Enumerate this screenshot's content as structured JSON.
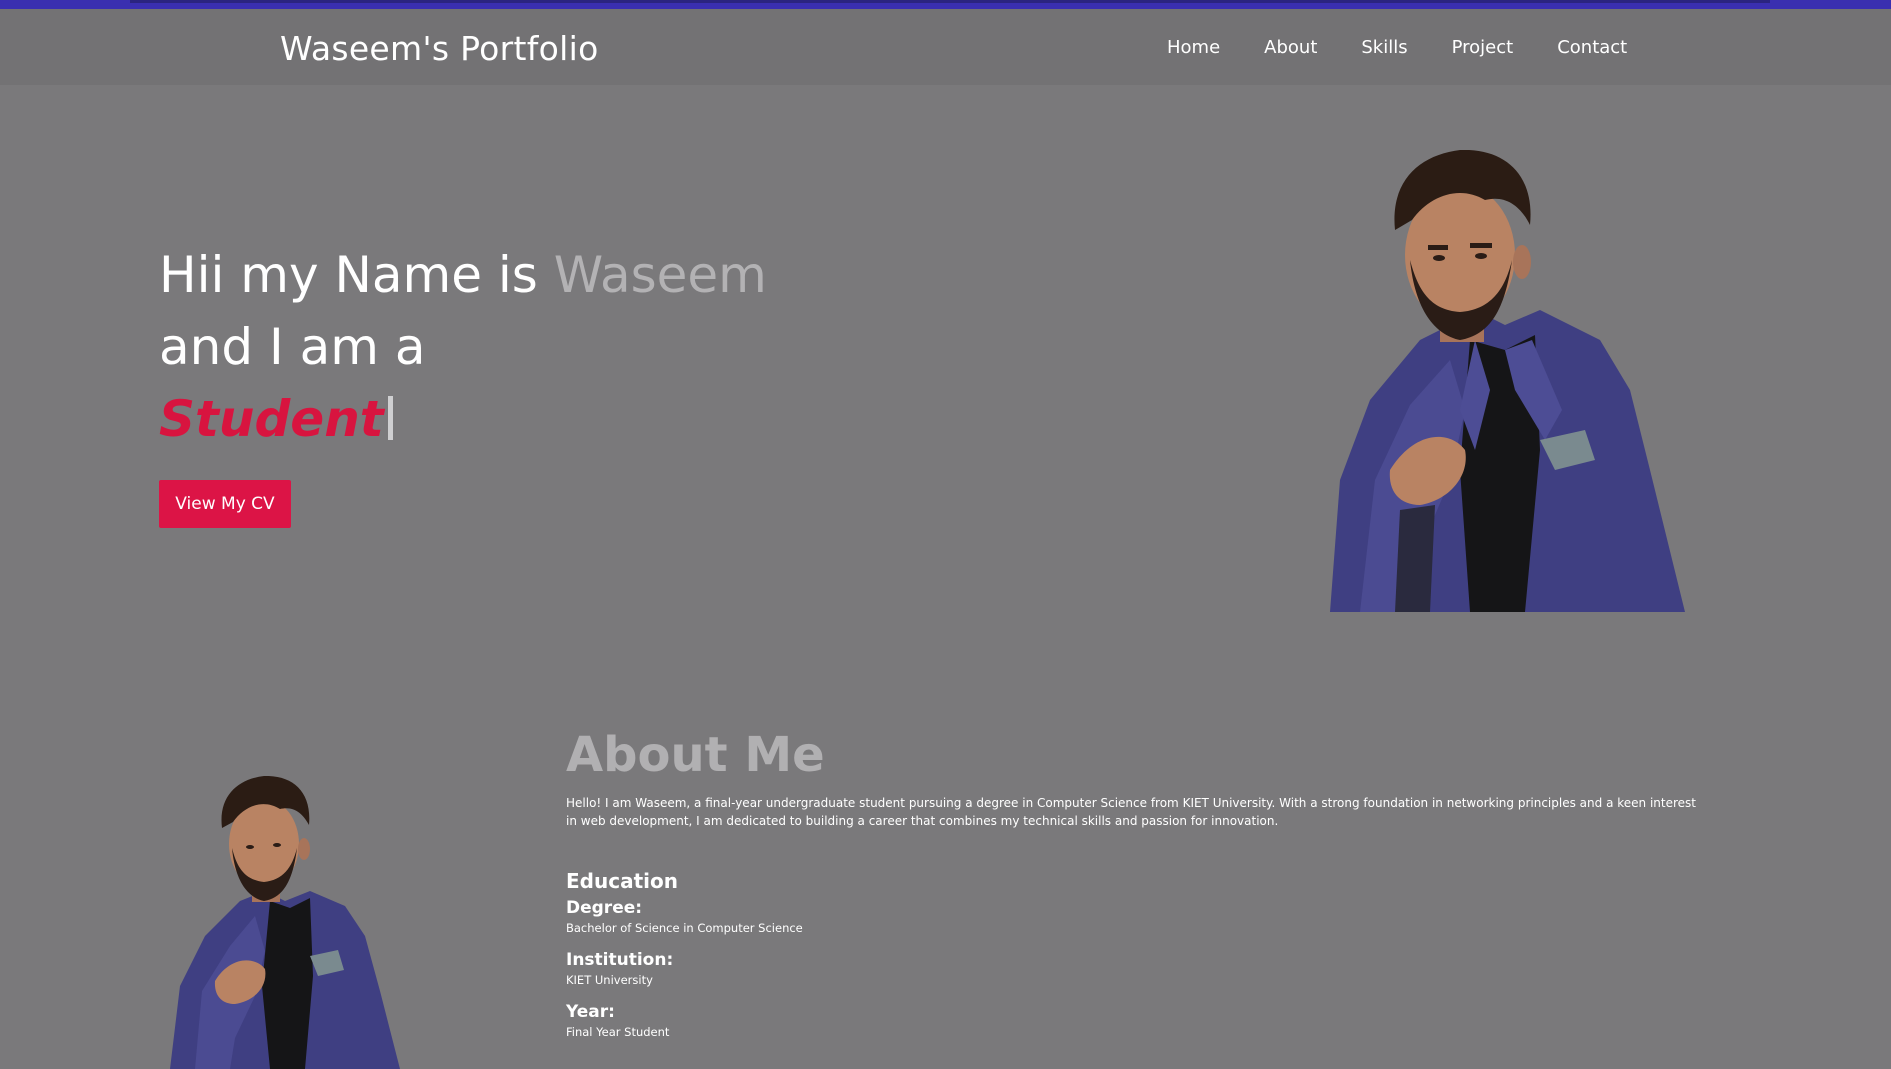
{
  "header": {
    "brand": "Waseem's Portfolio",
    "nav": [
      {
        "label": "Home"
      },
      {
        "label": "About"
      },
      {
        "label": "Skills"
      },
      {
        "label": "Project"
      },
      {
        "label": "Contact"
      }
    ]
  },
  "hero": {
    "intro": "Hii my Name is ",
    "name": "Waseem",
    "line2": "and I am a",
    "role": "Student",
    "cv_button": "View My CV"
  },
  "about": {
    "title": "About Me",
    "text": "Hello! I am Waseem, a final-year undergraduate student pursuing a degree in Computer Science from KIET University. With a strong foundation in networking principles and a keen interest in web development, I am dedicated to building a career that combines my technical skills and passion for innovation.",
    "education": {
      "title": "Education",
      "degree_label": "Degree:",
      "degree": "Bachelor of Science in Computer Science",
      "institution_label": "Institution:",
      "institution": "KIET University",
      "year_label": "Year:",
      "year": "Final Year Student"
    }
  },
  "colors": {
    "page_background": "#7a797b",
    "navbar_background": "#737274",
    "accent": "#dc1446",
    "top_bar": "#3a2fb0",
    "muted_text": "#b3b2b4"
  }
}
